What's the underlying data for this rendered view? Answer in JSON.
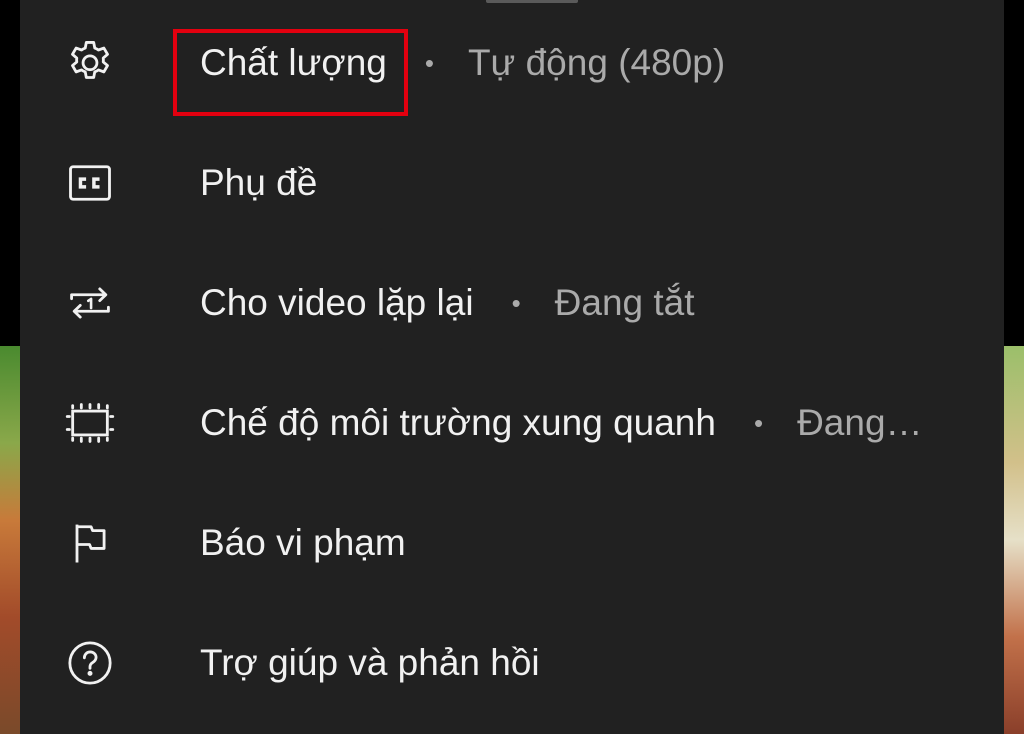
{
  "menu": {
    "items": [
      {
        "id": "quality",
        "label": "Chất lượng",
        "value": "Tự động (480p)",
        "icon": "gear-icon"
      },
      {
        "id": "captions",
        "label": "Phụ đề",
        "value": "",
        "icon": "closed-captions-icon"
      },
      {
        "id": "loop",
        "label": "Cho video lặp lại",
        "value": "Đang tắt",
        "icon": "repeat-one-icon"
      },
      {
        "id": "ambient",
        "label": "Chế độ môi trường xung quanh",
        "value": "Đang…",
        "icon": "ambient-mode-icon"
      },
      {
        "id": "report",
        "label": "Báo vi phạm",
        "value": "",
        "icon": "flag-icon"
      },
      {
        "id": "help",
        "label": "Trợ giúp và phản hồi",
        "value": "",
        "icon": "help-circle-icon"
      }
    ],
    "separator": "•"
  },
  "colors": {
    "sheet_background": "#212121",
    "primary_text": "#f1f1f1",
    "secondary_text": "#aaaaaa",
    "highlight_border": "#e3000f"
  }
}
